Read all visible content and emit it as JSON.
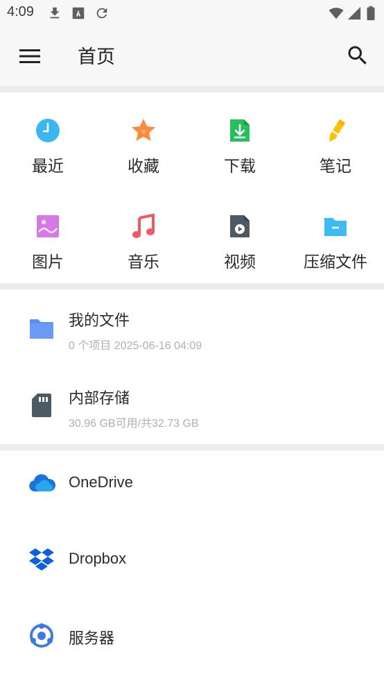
{
  "status_bar": {
    "time": "4:09",
    "icons": [
      "download-icon",
      "font-icon",
      "refresh-icon",
      "wifi-icon",
      "signal-icon",
      "battery-icon"
    ]
  },
  "app_bar": {
    "title": "首页",
    "menu_icon": "hamburger-menu-icon",
    "search_icon": "search-icon"
  },
  "categories": [
    {
      "label": "最近",
      "icon": "recent-clock-icon",
      "color": "#3cb6f0"
    },
    {
      "label": "收藏",
      "icon": "star-icon",
      "color": "#ff8a3d"
    },
    {
      "label": "下载",
      "icon": "download-file-icon",
      "color": "#25c05b"
    },
    {
      "label": "笔记",
      "icon": "pencil-icon",
      "color": "#ffc107"
    },
    {
      "label": "图片",
      "icon": "image-icon",
      "color": "#d977e6"
    },
    {
      "label": "音乐",
      "icon": "music-icon",
      "color": "#f05a63"
    },
    {
      "label": "视频",
      "icon": "video-file-icon",
      "color": "#4d5a63"
    },
    {
      "label": "压缩文件",
      "icon": "folder-archive-icon",
      "color": "#3cbcf0"
    }
  ],
  "storage": [
    {
      "title": "我的文件",
      "subtitle": "0 个项目 2025-06-16 04:09",
      "icon": "folder-icon",
      "color": "#5b8ff5"
    },
    {
      "title": "内部存储",
      "subtitle": "30.96 GB可用/共32.73 GB",
      "icon": "sd-card-icon",
      "color": "#4d5a63"
    }
  ],
  "cloud": [
    {
      "title": "OneDrive",
      "icon": "onedrive-icon",
      "color": "#1a73d9"
    },
    {
      "title": "Dropbox",
      "icon": "dropbox-icon",
      "color": "#0a62e0"
    },
    {
      "title": "服务器",
      "icon": "server-network-icon",
      "color": "#3d7be3"
    }
  ]
}
